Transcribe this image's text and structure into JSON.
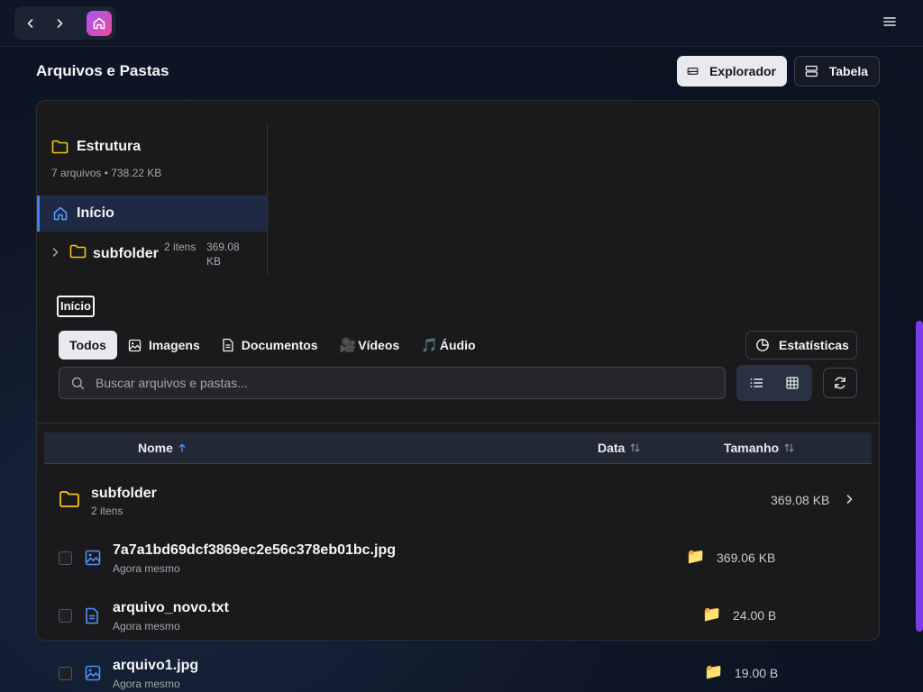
{
  "nav": {
    "back_label": "Voltar",
    "forward_label": "Avançar",
    "home_icon": "home-icon",
    "menu_icon": "hamburger-menu-icon"
  },
  "header": {
    "title": "Arquivos e Pastas",
    "view_explorer": "Explorador",
    "view_table": "Tabela"
  },
  "tree": {
    "title": "Estrutura",
    "summary": "7 arquivos • 738.22 KB",
    "root_label": "Início",
    "nodes": [
      {
        "name": "subfolder",
        "count": "2 itens",
        "size": "369.08 KB"
      }
    ]
  },
  "breadcrumb": {
    "current": "Início"
  },
  "filters": {
    "tabs": [
      "Todos",
      "Imagens",
      "Documentos",
      "Vídeos",
      "Áudio"
    ],
    "active": "Todos",
    "stats_label": "Estatísticas"
  },
  "search": {
    "placeholder": "Buscar arquivos e pastas...",
    "value": ""
  },
  "table": {
    "columns": {
      "name": "Nome",
      "date": "Data",
      "size": "Tamanho"
    },
    "rows": [
      {
        "type": "folder",
        "name": "subfolder",
        "meta": "2 itens",
        "size": "369.08 KB"
      },
      {
        "type": "image",
        "name": "7a7a1bd69dcf3869ec2e56c378eb01bc.jpg",
        "meta": "Agora mesmo",
        "size": "369.06 KB"
      },
      {
        "type": "document",
        "name": "arquivo_novo.txt",
        "meta": "Agora mesmo",
        "size": "24.00 B"
      },
      {
        "type": "image",
        "name": "arquivo1.jpg",
        "meta": "Agora mesmo",
        "size": "19.00 B"
      }
    ]
  },
  "colors": {
    "accent": "#3b82f6",
    "folder": "#f5c518",
    "brand_gradient_start": "#a855f7",
    "brand_gradient_end": "#ec4899"
  }
}
